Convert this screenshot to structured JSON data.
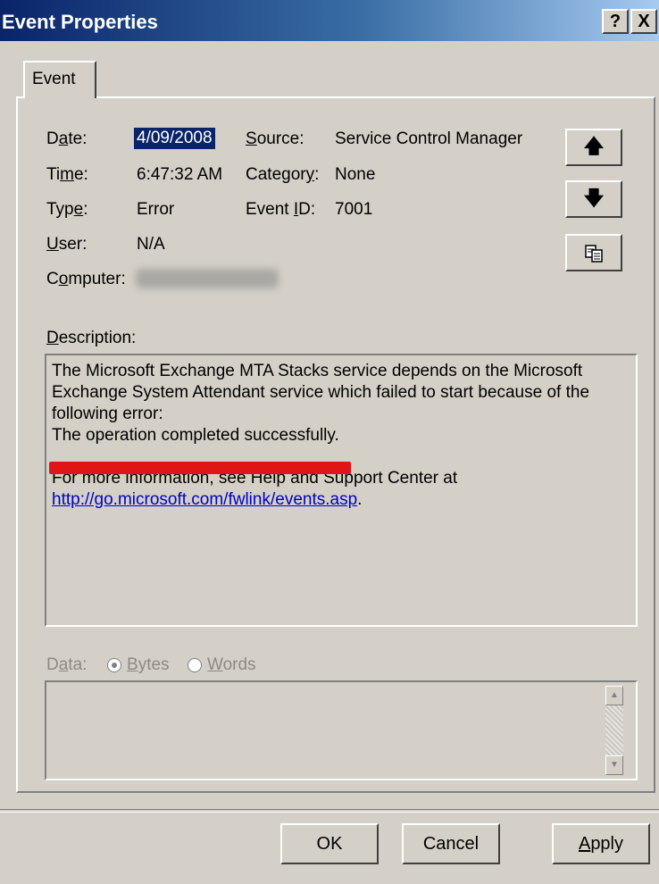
{
  "window": {
    "title": "Event Properties",
    "help_label": "?",
    "close_label": "X"
  },
  "tabs": [
    {
      "label": "Event"
    }
  ],
  "fields": {
    "date": {
      "pre": "D",
      "ul": "a",
      "post": "te:",
      "value": "4/09/2008"
    },
    "time": {
      "pre": "Ti",
      "ul": "m",
      "post": "e:",
      "value": "6:47:32 AM"
    },
    "type": {
      "pre": "Typ",
      "ul": "e",
      "post": ":",
      "value": "Error"
    },
    "user": {
      "pre": "",
      "ul": "U",
      "post": "ser:",
      "value": "N/A"
    },
    "computer": {
      "pre": "C",
      "ul": "o",
      "post": "mputer:",
      "value": ""
    },
    "source": {
      "pre": "",
      "ul": "S",
      "post": "ource:",
      "value": "Service Control Manager"
    },
    "category": {
      "pre": "Categor",
      "ul": "y",
      "post": ":",
      "value": "None"
    },
    "event_id": {
      "pre": "Event ",
      "ul": "I",
      "post": "D:",
      "value": "7001"
    }
  },
  "nav_icons": [
    "up-arrow-icon",
    "down-arrow-icon",
    "copy-icon"
  ],
  "description": {
    "label_ul": "D",
    "label_rest": "escription:",
    "line1": "The Microsoft Exchange MTA Stacks service depends on the Microsoft",
    "line2": "Exchange System Attendant service which failed to start because of the",
    "line3": "following error:",
    "line4": "The operation completed successfully.",
    "line5": "For more information, see Help and Support Center at",
    "link": "http://go.microsoft.com/fwlink/events.asp",
    "link_suffix": "."
  },
  "data_section": {
    "label_pre": "D",
    "label_ul": "a",
    "label_post": "ta:",
    "bytes_ul": "B",
    "bytes_rest": "ytes",
    "words_ul": "W",
    "words_rest": "ords",
    "selected": "bytes"
  },
  "buttons": {
    "ok": "OK",
    "cancel": "Cancel",
    "apply_ul": "A",
    "apply_rest": "pply"
  },
  "colors": {
    "title_bar_start": "#0a246a",
    "title_bar_end": "#a6caf0",
    "dialog_face": "#d4d0c8",
    "selection": "#0a246a",
    "link": "#0000cc",
    "annotation_red": "#e01616"
  }
}
